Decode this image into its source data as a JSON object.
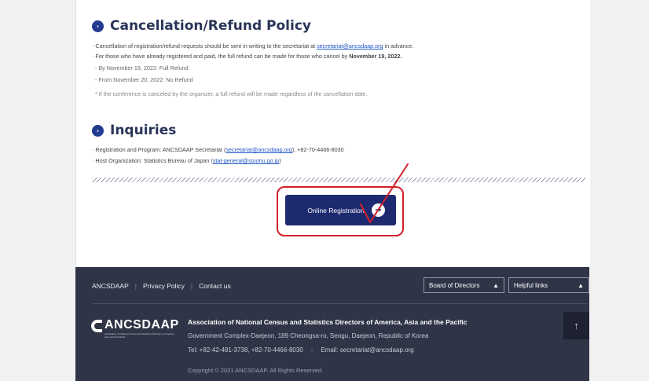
{
  "cancellation": {
    "title": "Cancellation/Refund Policy",
    "line1_prefix": "· Cancellation of registration/refund requests should be sent in writing to the secretariat at ",
    "line1_email": "secretariat@ancsdaap.org",
    "line1_suffix": " in advance.",
    "line2_prefix": "· For those who have already registered and paid, the full refund can be made for those who cancel by ",
    "line2_date": "November 19, 2022.",
    "sub1": "- By November 19, 2022: Full Refund",
    "sub2": "- From November 20, 2022: No Refund",
    "note": "* If the conference is canceled by the organizer, a full refund will be made regardless of the cancellation date."
  },
  "inquiries": {
    "title": "Inquiries",
    "line1_prefix": "· Registration and Program: ANCSDAAP Secretariat (",
    "line1_email": "secretariat@ancsdaap.org",
    "line1_suffix": "), +82-70-4466-8030",
    "line2_prefix": "· Host Organization: Statistics Bureau of Japan (",
    "line2_email": "stat-general@soumu.go.jp",
    "line2_suffix": ")"
  },
  "registration": {
    "button_label": "Online Registration",
    "button_icon": "arrow-right-icon"
  },
  "footer": {
    "nav": [
      "ANCSDAAP",
      "Privacy Policy",
      "Contact us"
    ],
    "select1": "Board of Directors",
    "select2": "Helpful links",
    "logo_text": "ANCSDAAP",
    "logo_small": "Association of National Census and Statistics Directors of America, Asia and the Pacific",
    "org_name": "Association of National Census and Statistics Directors of America, Asia and the Pacific",
    "address": "Government Complex-Daejeon, 189 Cheongsa-ro, Seogu, Daejeon, Republic of Korea",
    "tel": "Tel: +82-42-481-3738, +82-70-4466-8030",
    "email": "Email: secretariat@ancsdaap.org",
    "copyright": "Copyright © 2021 ANCSDAAP. All Rights Reserved."
  },
  "colors": {
    "accent": "#223a8f",
    "button": "#1e2a70",
    "footer_bg": "#2f3446",
    "annotation": "#d3202a",
    "link": "#1e55c7"
  }
}
